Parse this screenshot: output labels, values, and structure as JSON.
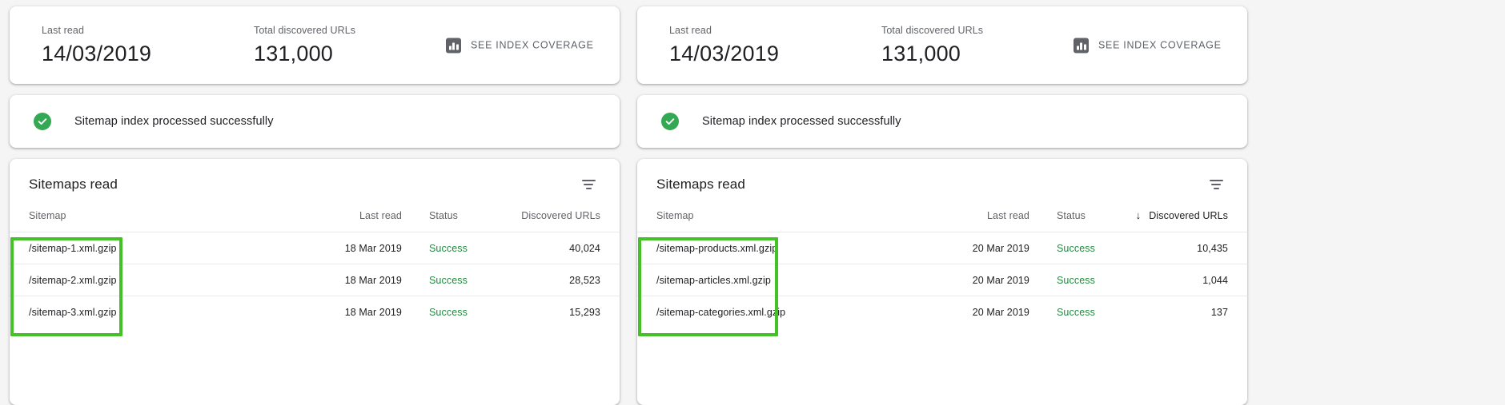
{
  "panels": [
    {
      "summary": {
        "last_read_label": "Last read",
        "last_read_value": "14/03/2019",
        "total_urls_label": "Total discovered URLs",
        "total_urls_value": "131,000",
        "coverage_link_label": "SEE INDEX COVERAGE",
        "coverage_icon": "bar-chart-icon"
      },
      "banner": {
        "icon": "check-circle-icon",
        "icon_color": "#34a853",
        "message": "Sitemap index processed successfully"
      },
      "table": {
        "title": "Sitemaps read",
        "filter_icon": "filter-icon",
        "columns": {
          "sitemap": "Sitemap",
          "last_read": "Last read",
          "status": "Status",
          "discovered_urls": "Discovered URLs"
        },
        "sorted_column": "",
        "sort_arrow": "",
        "rows": [
          {
            "sitemap": "/sitemap-1.xml.gzip",
            "last_read": "18 Mar 2019",
            "status": "Success",
            "discovered_urls": "40,024"
          },
          {
            "sitemap": "/sitemap-2.xml.gzip",
            "last_read": "18 Mar 2019",
            "status": "Success",
            "discovered_urls": "28,523"
          },
          {
            "sitemap": "/sitemap-3.xml.gzip",
            "last_read": "18 Mar 2019",
            "status": "Success",
            "discovered_urls": "15,293"
          }
        ]
      }
    },
    {
      "summary": {
        "last_read_label": "Last read",
        "last_read_value": "14/03/2019",
        "total_urls_label": "Total discovered URLs",
        "total_urls_value": "131,000",
        "coverage_link_label": "SEE INDEX COVERAGE",
        "coverage_icon": "bar-chart-icon"
      },
      "banner": {
        "icon": "check-circle-icon",
        "icon_color": "#34a853",
        "message": "Sitemap index processed successfully"
      },
      "table": {
        "title": "Sitemaps read",
        "filter_icon": "filter-icon",
        "columns": {
          "sitemap": "Sitemap",
          "last_read": "Last read",
          "status": "Status",
          "discovered_urls": "Discovered URLs"
        },
        "sorted_column": "discovered_urls",
        "sort_arrow": "↓",
        "rows": [
          {
            "sitemap": "/sitemap-products.xml.gzip",
            "last_read": "20 Mar 2019",
            "status": "Success",
            "discovered_urls": "10,435"
          },
          {
            "sitemap": "/sitemap-articles.xml.gzip",
            "last_read": "20 Mar 2019",
            "status": "Success",
            "discovered_urls": "1,044"
          },
          {
            "sitemap": "/sitemap-categories.xml.gzip",
            "last_read": "20 Mar 2019",
            "status": "Success",
            "discovered_urls": "137"
          }
        ]
      }
    }
  ],
  "annotations": {
    "color": "#44c127",
    "boxes": [
      {
        "target": "left-sitemap-column"
      },
      {
        "target": "right-sitemap-column"
      }
    ]
  }
}
